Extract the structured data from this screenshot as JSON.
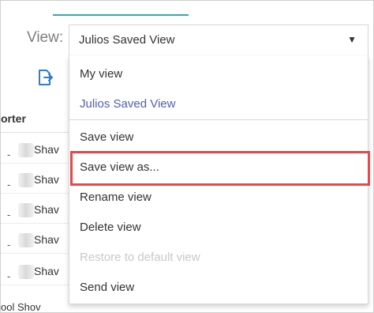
{
  "view_label": "View:",
  "view_select": {
    "value": "Julios Saved View",
    "caret_icon": "caret-down-icon"
  },
  "toolbar": {
    "icon": "export-icon"
  },
  "table": {
    "column_header": "orter",
    "rows": [
      "Shav",
      "Shav",
      "Shav",
      "Shav",
      "Shav"
    ],
    "last_row": "ool Shov"
  },
  "menu": {
    "my_view": "My view",
    "julios_saved_view": "Julios Saved View",
    "save_view": "Save view",
    "save_view_as": "Save view as...",
    "rename_view": "Rename view",
    "delete_view": "Delete view",
    "restore_default": "Restore to default view",
    "send_view": "Send view"
  },
  "colors": {
    "accent_tab": "#3aa6a6",
    "selected_item": "#4d5fb3",
    "highlight": "#e9474a",
    "disabled": "#c8c8c8"
  }
}
